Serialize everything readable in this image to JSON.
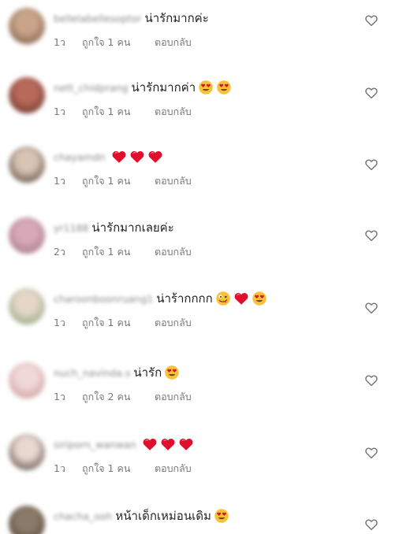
{
  "comments": [
    {
      "username": "bellelabellesoptor",
      "text": "น่ารักมากค่ะ",
      "emojis": [],
      "time": "1ว",
      "likes": "ถูกใจ 1 คน",
      "reply": "ตอบกลับ",
      "avatar_colors": [
        "#c9a48a",
        "#6b4f3b"
      ]
    },
    {
      "username": "nett_chidprang",
      "text": "น่ารักมากค่า",
      "emojis": [
        "heart-eyes",
        "heart-eyes"
      ],
      "time": "1ว",
      "likes": "ถูกใจ 1 คน",
      "reply": "ตอบกลับ",
      "avatar_colors": [
        "#b86a5a",
        "#5a2a22"
      ]
    },
    {
      "username": "chayamdn",
      "text": "",
      "emojis": [
        "red-heart",
        "red-heart",
        "red-heart"
      ],
      "time": "1ว",
      "likes": "ถูกใจ 1 คน",
      "reply": "ตอบกลับ",
      "avatar_colors": [
        "#d8c4b4",
        "#3b2c24"
      ]
    },
    {
      "username": "yr1188",
      "text": "น่ารักมากเลยค่ะ",
      "emojis": [],
      "time": "2ว",
      "likes": "ถูกใจ 1 คน",
      "reply": "ตอบกลับ",
      "avatar_colors": [
        "#d6a8b8",
        "#9a6a7a"
      ]
    },
    {
      "username": "charoonboonruang1",
      "text": "น่าร้ากกกก",
      "emojis": [
        "zany-face",
        "red-heart",
        "heart-eyes"
      ],
      "time": "1ว",
      "likes": "ถูกใจ 1 คน",
      "reply": "ตอบกลับ",
      "avatar_colors": [
        "#e6d6c8",
        "#7a9a6a"
      ]
    },
    {
      "username": "nuch_navinda.s",
      "text": "น่ารัก",
      "emojis": [
        "heart-eyes"
      ],
      "time": "1ว",
      "likes": "ถูกใจ 2 คน",
      "reply": "ตอบกลับ",
      "avatar_colors": [
        "#f0d8d8",
        "#c48a8a"
      ]
    },
    {
      "username": "siriporn_wanwan",
      "text": "",
      "emojis": [
        "red-heart",
        "red-heart",
        "red-heart"
      ],
      "time": "1ว",
      "likes": "ถูกใจ 1 คน",
      "reply": "ตอบกลับ",
      "avatar_colors": [
        "#e8d8d0",
        "#3a2a24"
      ]
    },
    {
      "username": "chacha_ooh",
      "text": "หน้าเด็กเหม่อนเดิม",
      "emojis": [
        "heart-eyes"
      ],
      "time": "",
      "likes": "",
      "reply": "",
      "avatar_colors": [
        "#8a7a6a",
        "#4a3a2a"
      ]
    }
  ],
  "icons": {
    "like_button": "heart-outline-icon",
    "heart_eyes": "heart-eyes-emoji",
    "red_heart": "red-heart-emoji",
    "zany_face": "zany-face-emoji"
  },
  "colors": {
    "text": "#262626",
    "meta": "#7a7a7a",
    "username": "#8a8a8a",
    "heart_red": "#e0102d",
    "emoji_yellow": "#f7c23a"
  }
}
